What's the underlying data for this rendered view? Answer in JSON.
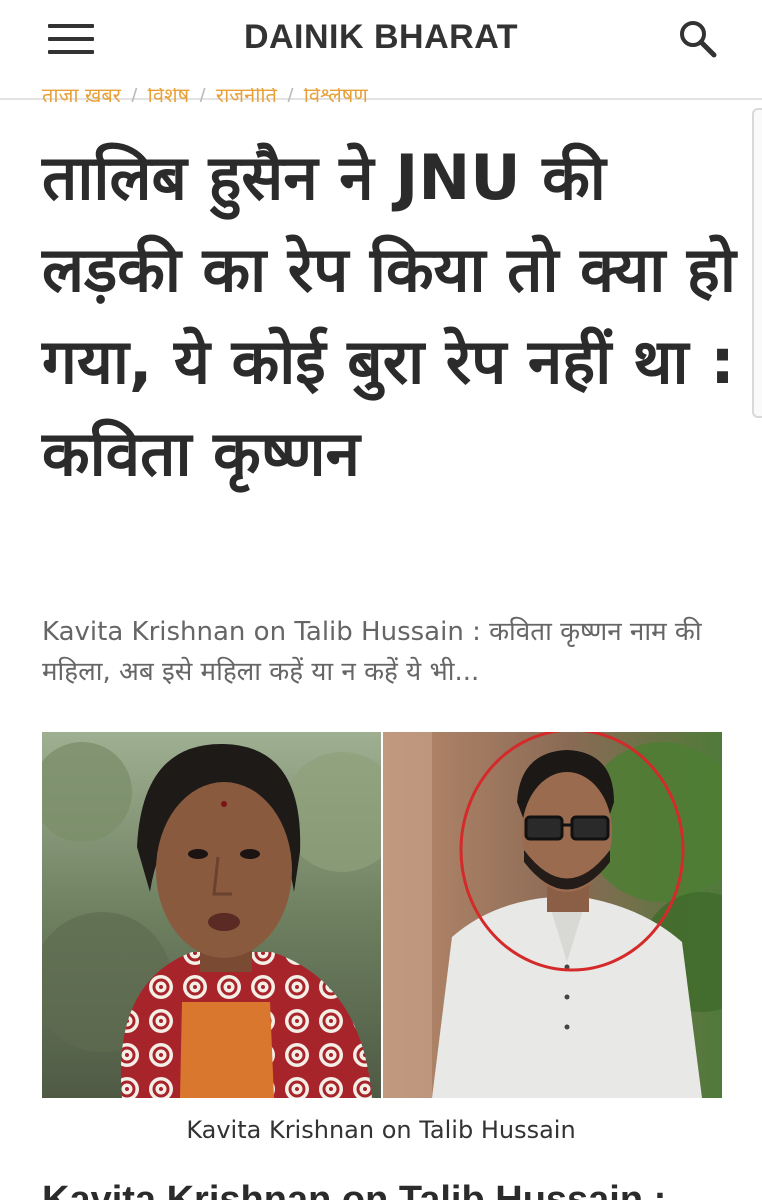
{
  "header": {
    "site_name": "DAINIK BHARAT",
    "menu_icon": "hamburger-menu-icon",
    "search_icon": "search-icon"
  },
  "breadcrumb": {
    "items": [
      "ताज़ा ख़बर",
      "विशेष",
      "राजनीति",
      "विश्लेषण"
    ]
  },
  "article": {
    "headline": "तालिब हुसैन ने JNU की लड़की का रेप किया तो क्या हो गया, ये कोई बुरा रेप नहीं था : कविता कृष्णन",
    "excerpt": "Kavita Krishnan on Talib Hussain : कविता कृष्णन नाम की महिला, अब इसे महिला कहें या न कहें ये भी...",
    "image_caption": "Kavita Krishnan on Talib Hussain",
    "next_heading": "Kavita Krishnan on Talib Hussain :"
  },
  "colors": {
    "accent": "#e8a13a",
    "text": "#2b2b2b",
    "muted": "#666666",
    "circle": "#d42a2a"
  }
}
